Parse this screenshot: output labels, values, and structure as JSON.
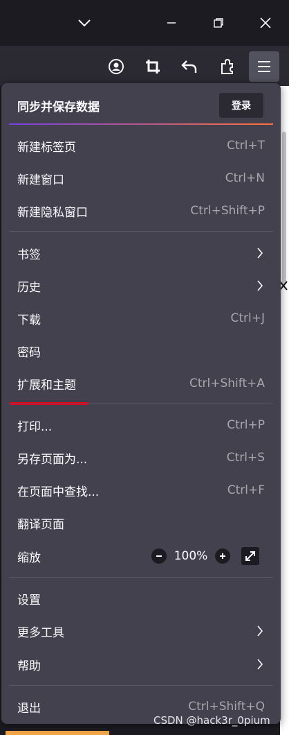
{
  "colors": {
    "accent_start": "#7542e5",
    "accent_end": "#ff7139",
    "annotation": "#e3001b"
  },
  "window_controls": {
    "tabs_icon": "chevron-down-icon",
    "minimize_icon": "minimize-icon",
    "restore_icon": "restore-icon",
    "close_icon": "close-icon"
  },
  "toolbar_icons": [
    "account-icon",
    "screenshot-crop-icon",
    "undo-icon",
    "extensions-icon",
    "hamburger-menu-icon"
  ],
  "menu": {
    "sync": {
      "title": "同步并保存数据",
      "login_label": "登录"
    },
    "items": [
      {
        "label": "新建标签页",
        "shortcut": "Ctrl+T"
      },
      {
        "label": "新建窗口",
        "shortcut": "Ctrl+N"
      },
      {
        "label": "新建隐私窗口",
        "shortcut": "Ctrl+Shift+P"
      },
      {
        "label": "书签",
        "shortcut": ""
      },
      {
        "label": "历史",
        "shortcut": ""
      },
      {
        "label": "下载",
        "shortcut": "Ctrl+J"
      },
      {
        "label": "密码",
        "shortcut": ""
      },
      {
        "label": "扩展和主题",
        "shortcut": "Ctrl+Shift+A"
      },
      {
        "label": "打印...",
        "shortcut": "Ctrl+P"
      },
      {
        "label": "另存页面为...",
        "shortcut": "Ctrl+S"
      },
      {
        "label": "在页面中查找...",
        "shortcut": "Ctrl+F"
      },
      {
        "label": "翻译页面",
        "shortcut": ""
      },
      {
        "label": "缩放",
        "shortcut": ""
      },
      {
        "label": "设置",
        "shortcut": ""
      },
      {
        "label": "更多工具",
        "shortcut": ""
      },
      {
        "label": "帮助",
        "shortcut": ""
      },
      {
        "label": "退出",
        "shortcut": "Ctrl+Shift+Q"
      }
    ],
    "zoom": {
      "value": "100%"
    }
  },
  "watermark": "CSDN @hack3r_0pium"
}
